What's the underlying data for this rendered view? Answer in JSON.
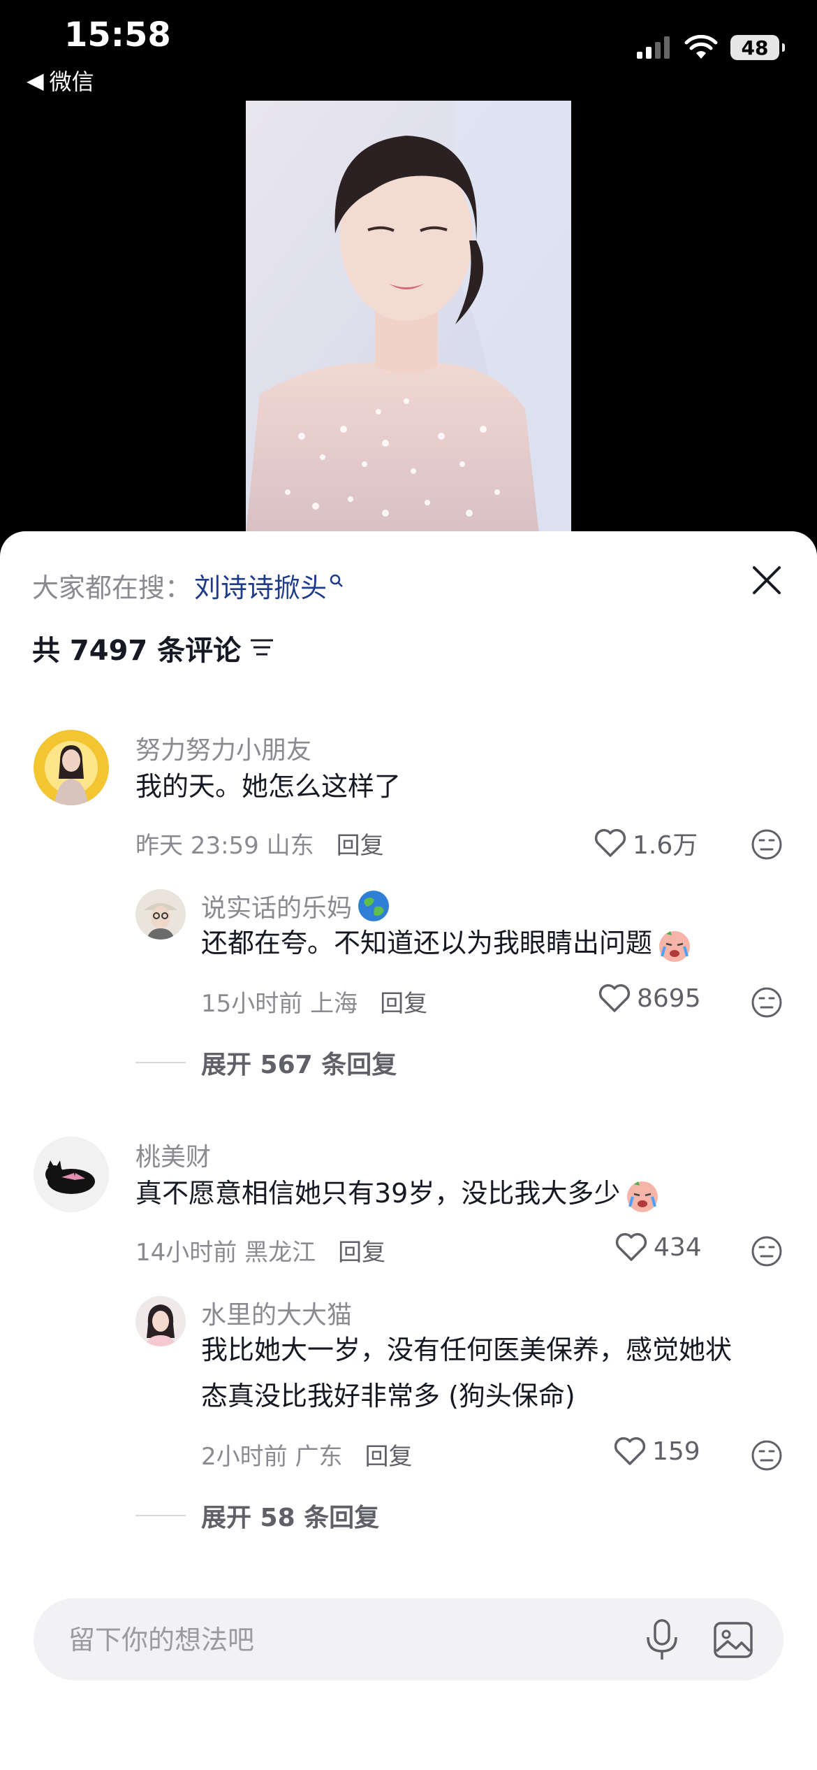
{
  "status_bar": {
    "time": "15:58",
    "back_app": "微信",
    "battery": "48"
  },
  "hot_search": {
    "prefix": "大家都在搜：",
    "keyword": "刘诗诗掀头"
  },
  "comments_header": {
    "count_text": "共 7497 条评论"
  },
  "comments": [
    {
      "user": "努力努力小朋友",
      "text": "我的天。她怎么这样了",
      "time_location": "昨天 23:59 山东",
      "reply_label": "回复",
      "likes": "1.6万",
      "replies": [
        {
          "user": "说实话的乐妈",
          "text": "还都在夸。不知道还以为我眼睛出问题",
          "time_location": "15小时前 上海",
          "reply_label": "回复",
          "likes": "8695"
        }
      ],
      "expand_label": "展开 567 条回复"
    },
    {
      "user": "桃美财",
      "text": "真不愿意相信她只有39岁，没比我大多少",
      "time_location": "14小时前 黑龙江",
      "reply_label": "回复",
      "likes": "434",
      "replies": [
        {
          "user": "水里的大大猫",
          "text_line1": "我比她大一岁，没有任何医美保养，感觉她状",
          "text_line2": "态真没比我好非常多 (狗头保命)",
          "time_location": "2小时前 广东",
          "reply_label": "回复",
          "likes": "159"
        }
      ],
      "expand_label": "展开 58 条回复"
    }
  ],
  "input": {
    "placeholder": "留下你的想法吧"
  }
}
